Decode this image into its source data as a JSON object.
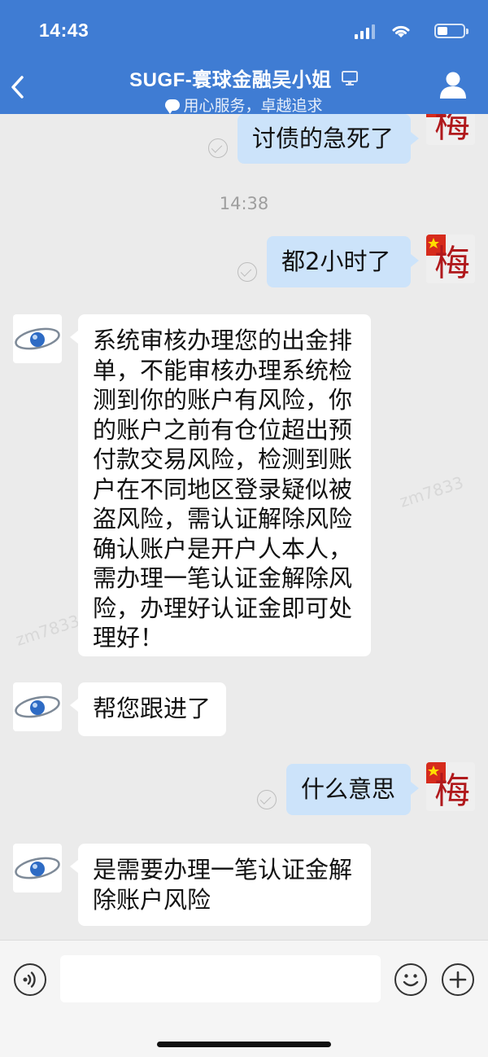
{
  "status_bar": {
    "time": "14:43"
  },
  "header": {
    "title": "SUGF-寰球金融吴小姐",
    "subtitle": "用心服务，卓越追求"
  },
  "messages": [
    {
      "sender": "me",
      "text": "讨债的急死了"
    },
    {
      "type": "time",
      "text": "14:38"
    },
    {
      "sender": "me",
      "text": "都2小时了"
    },
    {
      "sender": "agent",
      "text": "系统审核办理您的出金排单，不能审核办理系统检测到你的账户有风险，你的账户之前有仓位超出预付款交易风险，检测到账户在不同地区登录疑似被盗风险，需认证解除风险确认账户是开户人本人，需办理一笔认证金解除风险，办理好认证金即可处理好！"
    },
    {
      "sender": "agent",
      "text": "帮您跟进了"
    },
    {
      "sender": "me",
      "text": "什么意思"
    },
    {
      "sender": "agent",
      "text": "是需要办理一笔认证金解除账户风险"
    }
  ],
  "watermark": "zm7833",
  "avatar_self_char": "梅",
  "input": {
    "value": "",
    "placeholder": ""
  },
  "colors": {
    "header": "#3F7CD3",
    "self_bubble": "#CCE3FA",
    "other_bubble": "#FFFFFF",
    "background": "#EBEBEB"
  },
  "icons": [
    "back-chevron-icon",
    "monitor-icon",
    "user-profile-icon",
    "voice-icon",
    "emoji-icon",
    "plus-icon",
    "read-check-icon"
  ]
}
